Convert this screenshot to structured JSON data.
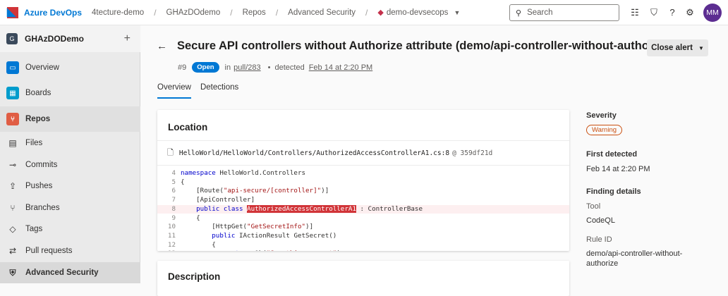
{
  "topbar": {
    "brand": "Azure DevOps",
    "breadcrumbs": [
      "4tecture-demo",
      "GHAzDOdemo",
      "Repos",
      "Advanced Security",
      "demo-devsecops"
    ],
    "search_placeholder": "Search",
    "avatar_initials": "MM"
  },
  "sidebar": {
    "project_initial": "G",
    "project_name": "GHAzDODemo",
    "items": [
      {
        "label": "Overview",
        "icon": "overview-icon",
        "color": "#0078d4"
      },
      {
        "label": "Boards",
        "icon": "boards-icon",
        "color": "#009ccc"
      },
      {
        "label": "Repos",
        "icon": "repos-icon",
        "color": "#e05d44"
      },
      {
        "label": "Files",
        "icon": "files-icon"
      },
      {
        "label": "Commits",
        "icon": "commits-icon"
      },
      {
        "label": "Pushes",
        "icon": "pushes-icon"
      },
      {
        "label": "Branches",
        "icon": "branches-icon"
      },
      {
        "label": "Tags",
        "icon": "tags-icon"
      },
      {
        "label": "Pull requests",
        "icon": "pull-requests-icon"
      },
      {
        "label": "Advanced Security",
        "icon": "shield-icon"
      }
    ]
  },
  "alert": {
    "title": "Secure API controllers without Authorize attribute (demo/api-controller-without-authorize)",
    "close_label": "Close alert",
    "number": "#9",
    "state": "Open",
    "in_text": "in",
    "pull_link": "pull/283",
    "detected_text": "detected",
    "detected_link": "Feb 14 at 2:20 PM",
    "tabs": [
      "Overview",
      "Detections"
    ]
  },
  "location": {
    "heading": "Location",
    "file_path": "HelloWorld/HelloWorld/Controllers/AuthorizedAccessControllerA1.cs:8",
    "commit": "@ 359df21d",
    "lines": [
      {
        "n": "4",
        "t": "namespace HelloWorld.Controllers"
      },
      {
        "n": "5",
        "t": "{"
      },
      {
        "n": "6",
        "t": "    [Route(\"api-secure/[controller]\")]"
      },
      {
        "n": "7",
        "t": "    [ApiController]"
      },
      {
        "n": "8",
        "pre": "    public class ",
        "mark": "AuthorizedAccessControllerA1",
        "post": " : ControllerBase"
      },
      {
        "n": "9",
        "t": "    {"
      },
      {
        "n": "10",
        "t": "        [HttpGet(\"GetSecretInfo\")]"
      },
      {
        "n": "11",
        "t": "        public IActionResult GetSecret()"
      },
      {
        "n": "12",
        "t": "        {"
      },
      {
        "n": "13",
        "t": "            return Ok(\"Something secret\");"
      }
    ]
  },
  "description": {
    "heading": "Description"
  },
  "details": {
    "severity_label": "Severity",
    "severity_value": "Warning",
    "first_detected_label": "First detected",
    "first_detected_value": "Feb 14 at 2:20 PM",
    "finding_label": "Finding details",
    "tool_label": "Tool",
    "tool_value": "CodeQL",
    "rule_label": "Rule ID",
    "rule_value_1": "demo/api-controller-without-",
    "rule_value_2": "authorize"
  }
}
